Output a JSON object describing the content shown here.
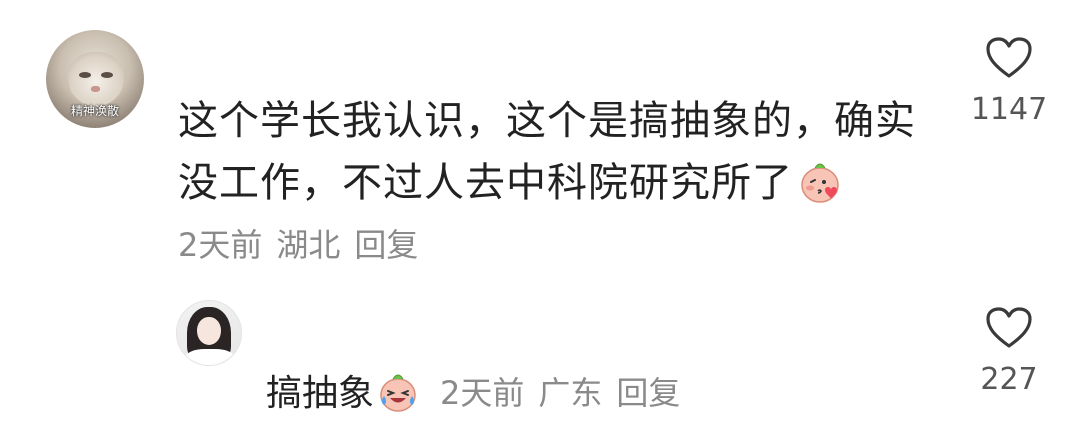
{
  "comment": {
    "avatar_caption": "精神涣散",
    "text": "这个学长我认识，这个是搞抽象的，确实没工作，不过人去中科院研究所了",
    "emoji": "blush-blowing-kiss-emoji",
    "time": "2天前",
    "location": "湖北",
    "reply_label": "回复",
    "like_count": "1147",
    "like_icon": "heart-outline-icon"
  },
  "reply": {
    "username": "搞抽象",
    "emoji": "laughing-tears-emoji",
    "time": "2天前",
    "location": "广东",
    "reply_label": "回复",
    "like_count": "227",
    "like_icon": "heart-outline-icon"
  },
  "colors": {
    "text_primary": "#222222",
    "text_secondary": "#8a8a8a",
    "emoji_peach": "#f5b8a8",
    "emoji_leaf": "#6cc24a",
    "emoji_heart": "#ef4a5a",
    "emoji_tear": "#4aa3f0"
  }
}
